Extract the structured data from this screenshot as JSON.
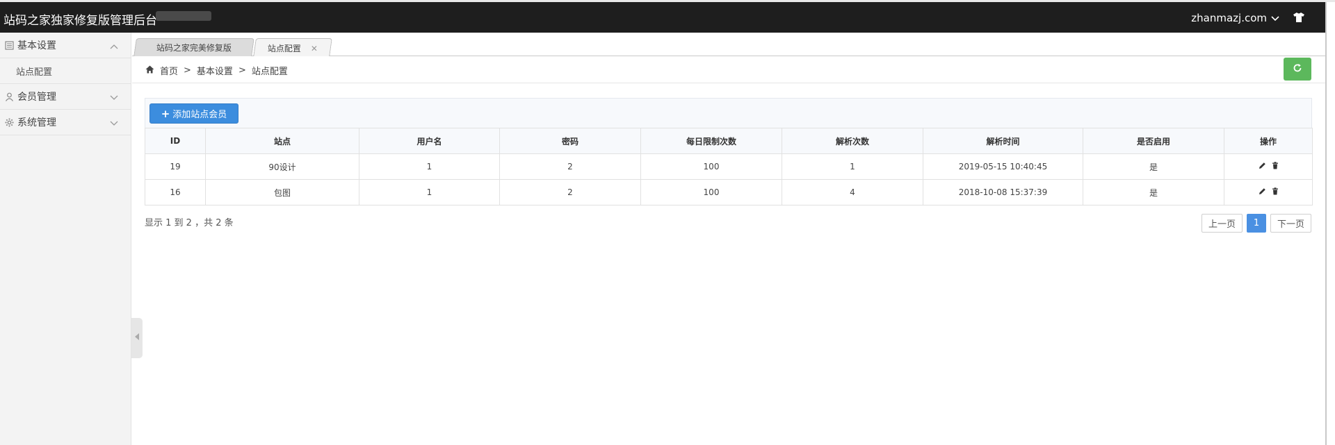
{
  "header": {
    "brand": "站码之家独家修复版管理后台",
    "user": "zhanmazj.com"
  },
  "sidebar": {
    "groups": [
      {
        "label": "基本设置",
        "sub": [
          "站点配置"
        ]
      },
      {
        "label": "会员管理"
      },
      {
        "label": "系统管理"
      }
    ]
  },
  "tabs": [
    "站码之家完美修复版",
    "站点配置"
  ],
  "breadcrumb": [
    "首页",
    "基本设置",
    "站点配置"
  ],
  "breadcrumb_sep": ">",
  "toolbar": {
    "add_label": "添加站点会员"
  },
  "table": {
    "columns": [
      "ID",
      "站点",
      "用户名",
      "密码",
      "每日限制次数",
      "解析次数",
      "解析时间",
      "是否启用",
      "操作"
    ],
    "rows": [
      [
        "19",
        "90设计",
        "1",
        "2",
        "100",
        "1",
        "2019-05-15 10:40:45",
        "是"
      ],
      [
        "16",
        "包图",
        "1",
        "2",
        "100",
        "4",
        "2018-10-08 15:37:39",
        "是"
      ]
    ]
  },
  "footer": {
    "summary": "显示 1 到 2 ，共 2 条"
  },
  "pager": {
    "prev": "上一页",
    "current": "1",
    "next": "下一页"
  },
  "colors": {
    "topbar": "#1e1e1e",
    "primary": "#3c8dde",
    "success": "#5cb85c",
    "active_page": "#4a90e2"
  }
}
